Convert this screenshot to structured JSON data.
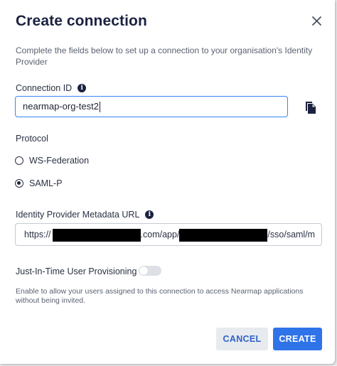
{
  "dialog": {
    "title": "Create connection",
    "description": "Complete the fields below to set up a connection to your organisation's Identity Provider"
  },
  "connection_id": {
    "label": "Connection ID",
    "value": "nearmap-org-test2"
  },
  "protocol": {
    "label": "Protocol",
    "options": [
      {
        "label": "WS-Federation",
        "selected": false
      },
      {
        "label": "SAML-P",
        "selected": true
      }
    ]
  },
  "metadata_url": {
    "label": "Identity Provider Metadata URL",
    "parts": [
      "https://",
      ".com/app/",
      "/sso/saml/m"
    ]
  },
  "jit": {
    "label": "Just-In-Time User Provisioning",
    "enabled": false,
    "hint": "Enable to allow your users assigned to this connection to access Nearmap applications without being invited."
  },
  "buttons": {
    "cancel": "CANCEL",
    "create": "CREATE"
  },
  "colors": {
    "primary": "#2f73e8",
    "focus_border": "#3b82f6",
    "title": "#1b2240"
  }
}
